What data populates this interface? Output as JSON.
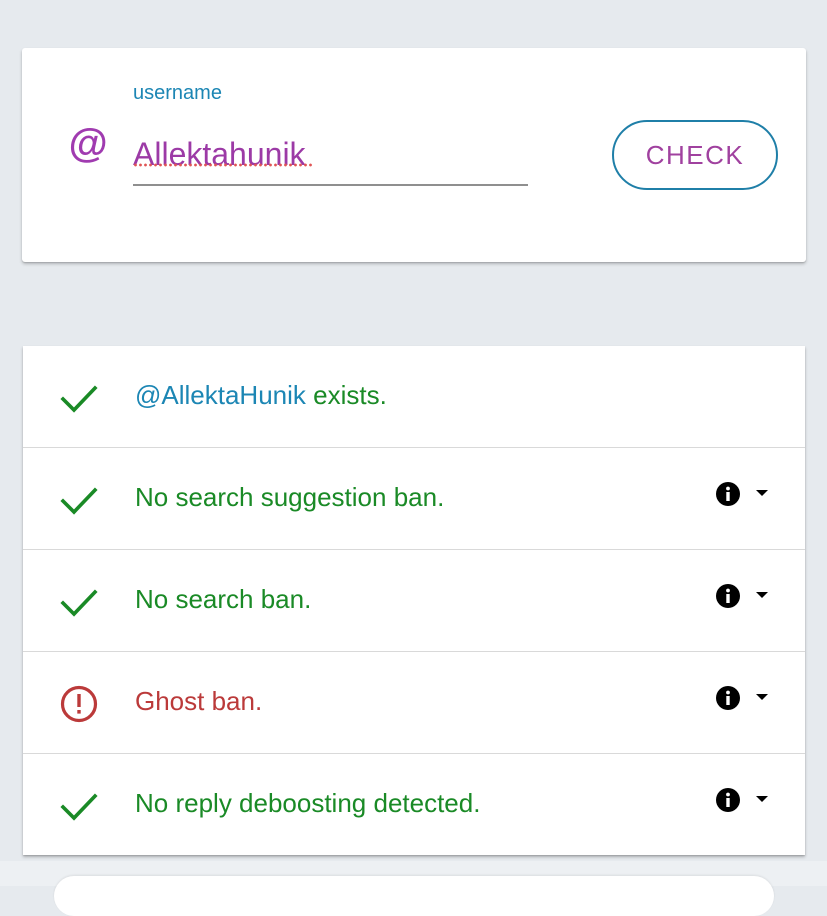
{
  "search": {
    "label": "username",
    "value": "Allektahunik",
    "at_symbol": "@",
    "icon": "at-icon",
    "button_label": "CHECK"
  },
  "results": [
    {
      "status": "ok",
      "icon": "checkmark-icon",
      "handle": "@AllektaHunik",
      "text": " exists.",
      "has_info": false
    },
    {
      "status": "ok",
      "icon": "checkmark-icon",
      "text": "No search suggestion ban.",
      "has_info": true
    },
    {
      "status": "ok",
      "icon": "checkmark-icon",
      "text": "No search ban.",
      "has_info": true
    },
    {
      "status": "bad",
      "icon": "exclamation-circle-icon",
      "text": "Ghost ban.",
      "has_info": true
    },
    {
      "status": "ok",
      "icon": "checkmark-icon",
      "text": "No reply deboosting detected.",
      "has_info": true
    }
  ],
  "colors": {
    "ok": "#1a8a26",
    "bad": "#bb3a3a",
    "accent_blue": "#1c86b4",
    "accent_purple": "#a03bb0",
    "background": "#e6eaee"
  }
}
